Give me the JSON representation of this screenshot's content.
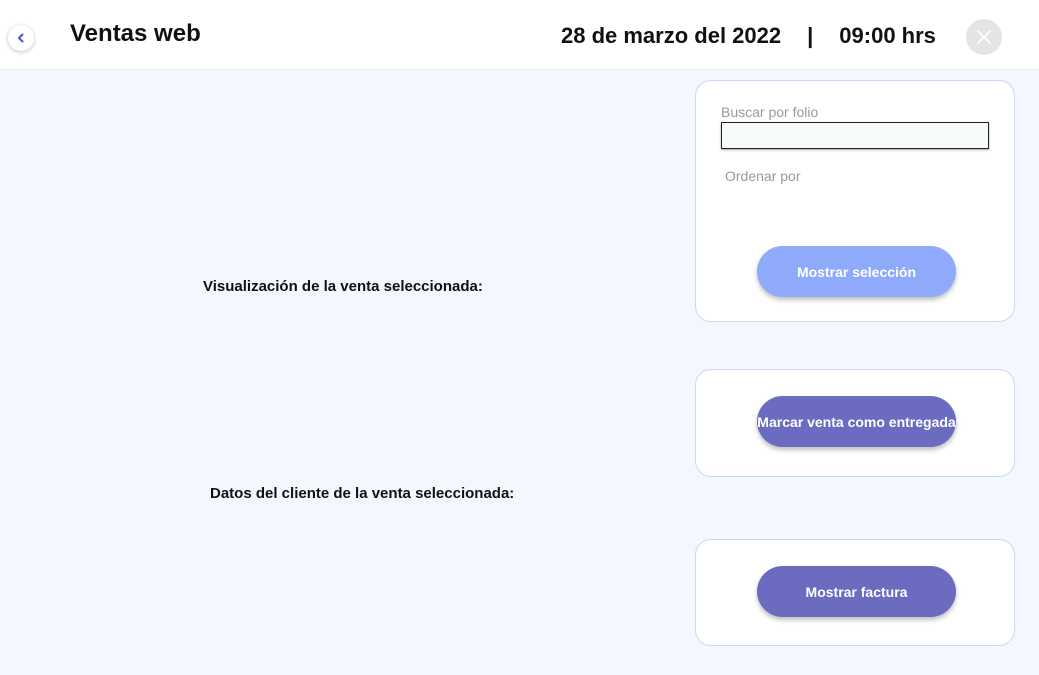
{
  "header": {
    "title": "Ventas web",
    "date": "28 de marzo del 2022",
    "separator": "|",
    "time": "09:00 hrs",
    "back_icon": "chevron-left-icon",
    "close_icon": "close-icon"
  },
  "main": {
    "sale_view_label": "Visualización de la venta seleccionada:",
    "client_data_label": "Datos del cliente de la venta seleccionada:"
  },
  "filter_card": {
    "search_label": "Buscar por folio",
    "search_value": "",
    "sort_label": "Ordenar por",
    "show_selection_button": "Mostrar selección"
  },
  "actions": {
    "mark_delivered_button": "Marcar venta como entregada",
    "show_invoice_button": "Mostrar factura"
  },
  "colors": {
    "accent": "#3f5bd8",
    "button_light": "#8fa9fb",
    "button_dark": "#6b6cc0",
    "card_border": "#c9d8f7",
    "background": "#f5f7fe"
  }
}
